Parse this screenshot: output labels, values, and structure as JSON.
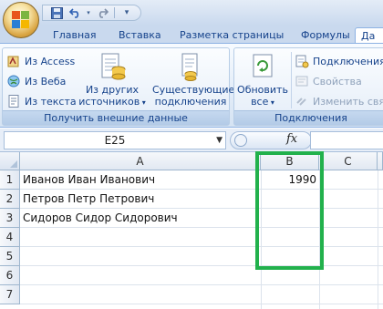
{
  "tabs": [
    "Главная",
    "Вставка",
    "Разметка страницы",
    "Формулы",
    "Да"
  ],
  "ribbon": {
    "external_group": {
      "label": "Получить внешние данные",
      "from_access": "Из Access",
      "from_web": "Из Веба",
      "from_text": "Из текста",
      "other_sources_line1": "Из других",
      "other_sources_line2": "источников",
      "existing_line1": "Существующие",
      "existing_line2": "подключения"
    },
    "connections_group": {
      "label": "Подключения",
      "refresh_line1": "Обновить",
      "refresh_line2": "все",
      "connections": "Подключения",
      "properties": "Свойства",
      "edit_links": "Изменить связ"
    }
  },
  "formula_bar": {
    "name_box": "E25",
    "fx": "fx",
    "formula": ""
  },
  "grid": {
    "columns": [
      "A",
      "B",
      "C"
    ],
    "rows": [
      "1",
      "2",
      "3",
      "4",
      "5",
      "6",
      "7"
    ],
    "cells": {
      "a1": "Иванов Иван Иванович",
      "b1": "1990",
      "a2": "Петров Петр Петрович",
      "a3": "Сидоров Сидор Сидорович"
    }
  },
  "colors": {
    "highlight": "#22b14c",
    "ribbon_text": "#15428b"
  }
}
